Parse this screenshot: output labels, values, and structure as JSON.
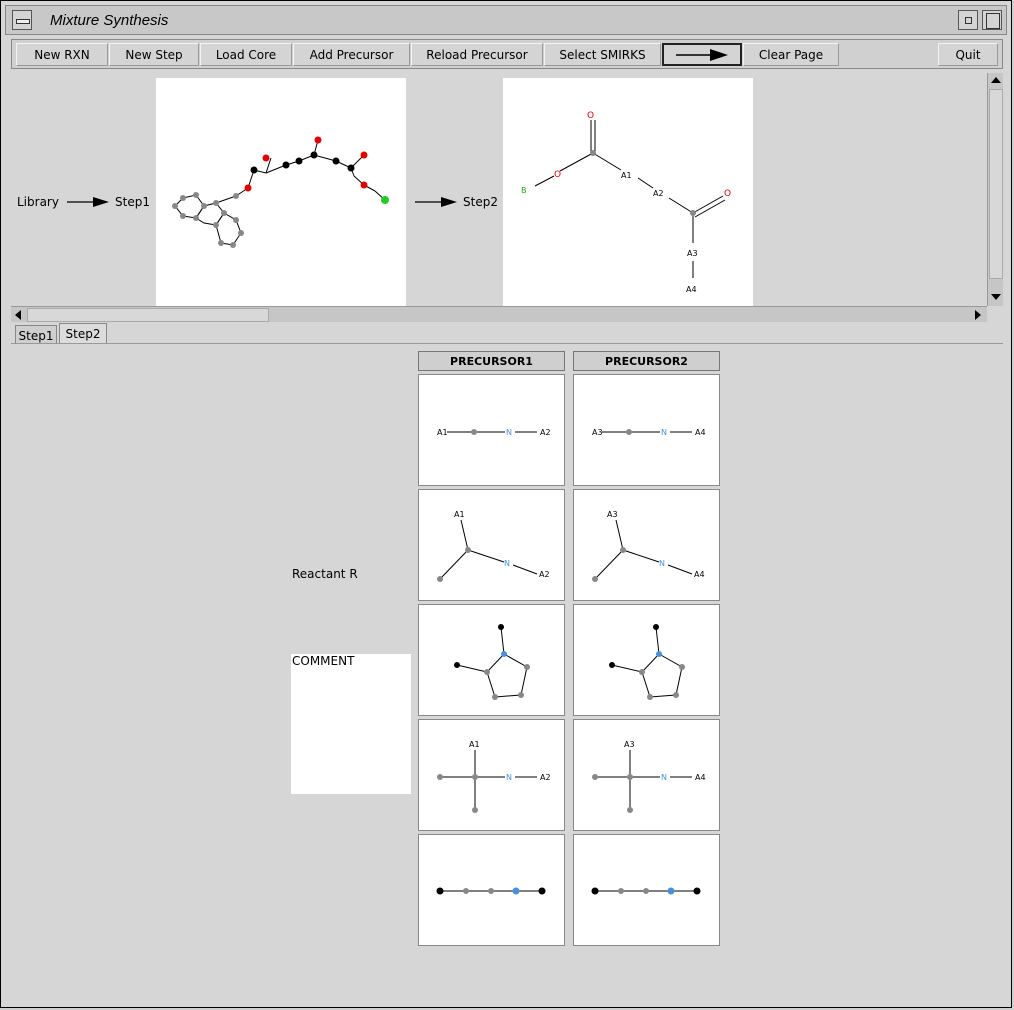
{
  "window": {
    "title": "Mixture Synthesis"
  },
  "toolbar": {
    "new_rxn": "New RXN",
    "new_step": "New Step",
    "load_core": "Load Core",
    "add_precursor": "Add Precursor",
    "reload_precursor": "Reload Precursor",
    "select_smirks": "Select SMIRKS",
    "arrow_icon": "right-arrow-icon",
    "clear_page": "Clear Page",
    "quit": "Quit"
  },
  "flow": {
    "library": "Library",
    "step1": "Step1",
    "step2": "Step2",
    "step2_labels": {
      "b": "B",
      "a1": "A1",
      "a2": "A2",
      "a3": "A3",
      "a4": "A4",
      "o": "O"
    }
  },
  "tabs": [
    {
      "label": "Step1"
    },
    {
      "label": "Step2"
    }
  ],
  "grid": {
    "headers": [
      "PRECURSOR1",
      "PRECURSOR2"
    ],
    "p1": {
      "a_left": "A1",
      "a_right": "A2",
      "n": "N"
    },
    "p2": {
      "a_left": "A3",
      "a_right": "A4",
      "n": "N"
    }
  },
  "side": {
    "reactant": "Reactant R",
    "comment": "COMMENT"
  },
  "colors": {
    "oxygen": "#e00000",
    "nitrogen": "#4a90d9",
    "halogen": "#22cc22",
    "carbon": "#888888"
  }
}
